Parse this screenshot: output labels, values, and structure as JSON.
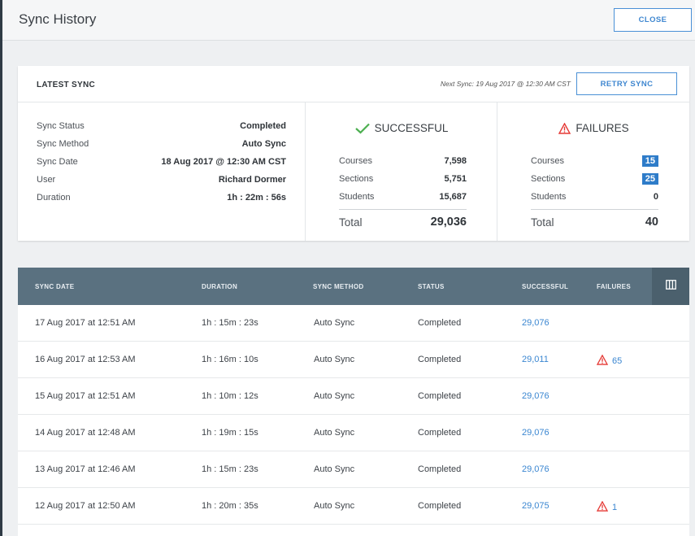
{
  "header": {
    "title": "Sync History",
    "close_label": "CLOSE"
  },
  "latest": {
    "label": "LATEST SYNC",
    "next_sync": "Next Sync: 19 Aug 2017 @ 12:30 AM CST",
    "retry_label": "RETRY SYNC",
    "info": [
      {
        "k": "Sync Status",
        "v": "Completed"
      },
      {
        "k": "Sync Method",
        "v": "Auto Sync"
      },
      {
        "k": "Sync Date",
        "v": "18 Aug 2017 @ 12:30 AM CST"
      },
      {
        "k": "User",
        "v": "Richard Dormer"
      },
      {
        "k": "Duration",
        "v": "1h : 22m : 56s"
      }
    ],
    "successful": {
      "title": "SUCCESSFUL",
      "rows": [
        {
          "k": "Courses",
          "v": "7,598"
        },
        {
          "k": "Sections",
          "v": "5,751"
        },
        {
          "k": "Students",
          "v": "15,687"
        }
      ],
      "total_label": "Total",
      "total": "29,036"
    },
    "failures": {
      "title": "FAILURES",
      "rows": [
        {
          "k": "Courses",
          "v": "15"
        },
        {
          "k": "Sections",
          "v": "25"
        },
        {
          "k": "Students",
          "v": "0"
        }
      ],
      "total_label": "Total",
      "total": "40"
    }
  },
  "table": {
    "headers": [
      "SYNC DATE",
      "DURATION",
      "SYNC METHOD",
      "STATUS",
      "SUCCESSFUL",
      "FAILURES"
    ],
    "rows": [
      {
        "date": "17 Aug 2017 at 12:51 AM",
        "duration": "1h : 15m : 23s",
        "method": "Auto Sync",
        "status": "Completed",
        "successful": "29,076",
        "failures": ""
      },
      {
        "date": "16 Aug 2017 at 12:53 AM",
        "duration": "1h : 16m : 10s",
        "method": "Auto Sync",
        "status": "Completed",
        "successful": "29,011",
        "failures": "65"
      },
      {
        "date": "15 Aug 2017 at 12:51 AM",
        "duration": "1h : 10m : 12s",
        "method": "Auto Sync",
        "status": "Completed",
        "successful": "29,076",
        "failures": ""
      },
      {
        "date": "14 Aug 2017 at 12:48 AM",
        "duration": "1h : 19m : 15s",
        "method": "Auto Sync",
        "status": "Completed",
        "successful": "29,076",
        "failures": ""
      },
      {
        "date": "13 Aug 2017 at 12:46 AM",
        "duration": "1h : 15m : 23s",
        "method": "Auto Sync",
        "status": "Completed",
        "successful": "29,076",
        "failures": ""
      },
      {
        "date": "12 Aug 2017 at 12:50 AM",
        "duration": "1h : 20m : 35s",
        "method": "Auto Sync",
        "status": "Completed",
        "successful": "29,075",
        "failures": "1"
      }
    ]
  },
  "colors": {
    "accent": "#3a86d1",
    "header_bar": "#5a7180",
    "success": "#4caf50",
    "danger": "#e53935"
  },
  "icons": {
    "success": "check-icon",
    "failure": "warning-triangle-icon",
    "columns": "columns-icon"
  }
}
